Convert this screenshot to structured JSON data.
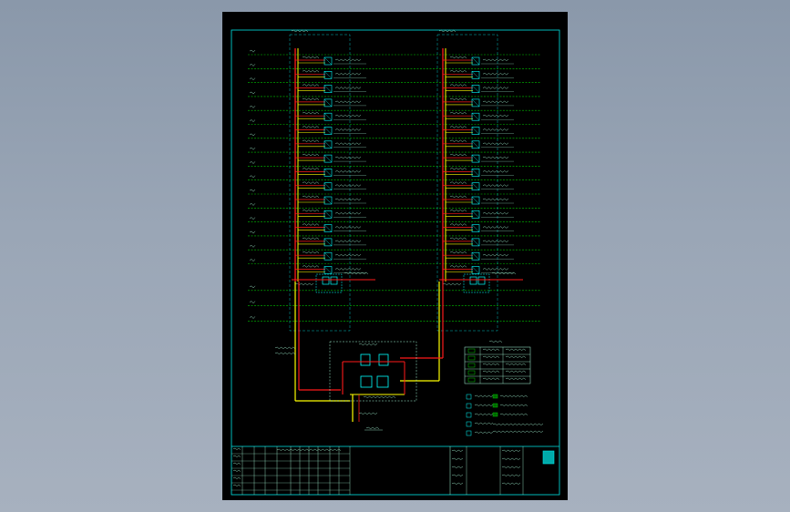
{
  "drawing": {
    "floors": 16,
    "riser_a_header": "",
    "riser_b_header": "",
    "plant_label": "",
    "notes": [],
    "title_block": {}
  },
  "colors": {
    "background": "#000000",
    "frame": "#00e5e5",
    "floor_line": "#00c800",
    "pipe_supply": "#ff1a1a",
    "pipe_return": "#ffff00",
    "equipment": "#00ffff",
    "text": "#aaffdd"
  }
}
